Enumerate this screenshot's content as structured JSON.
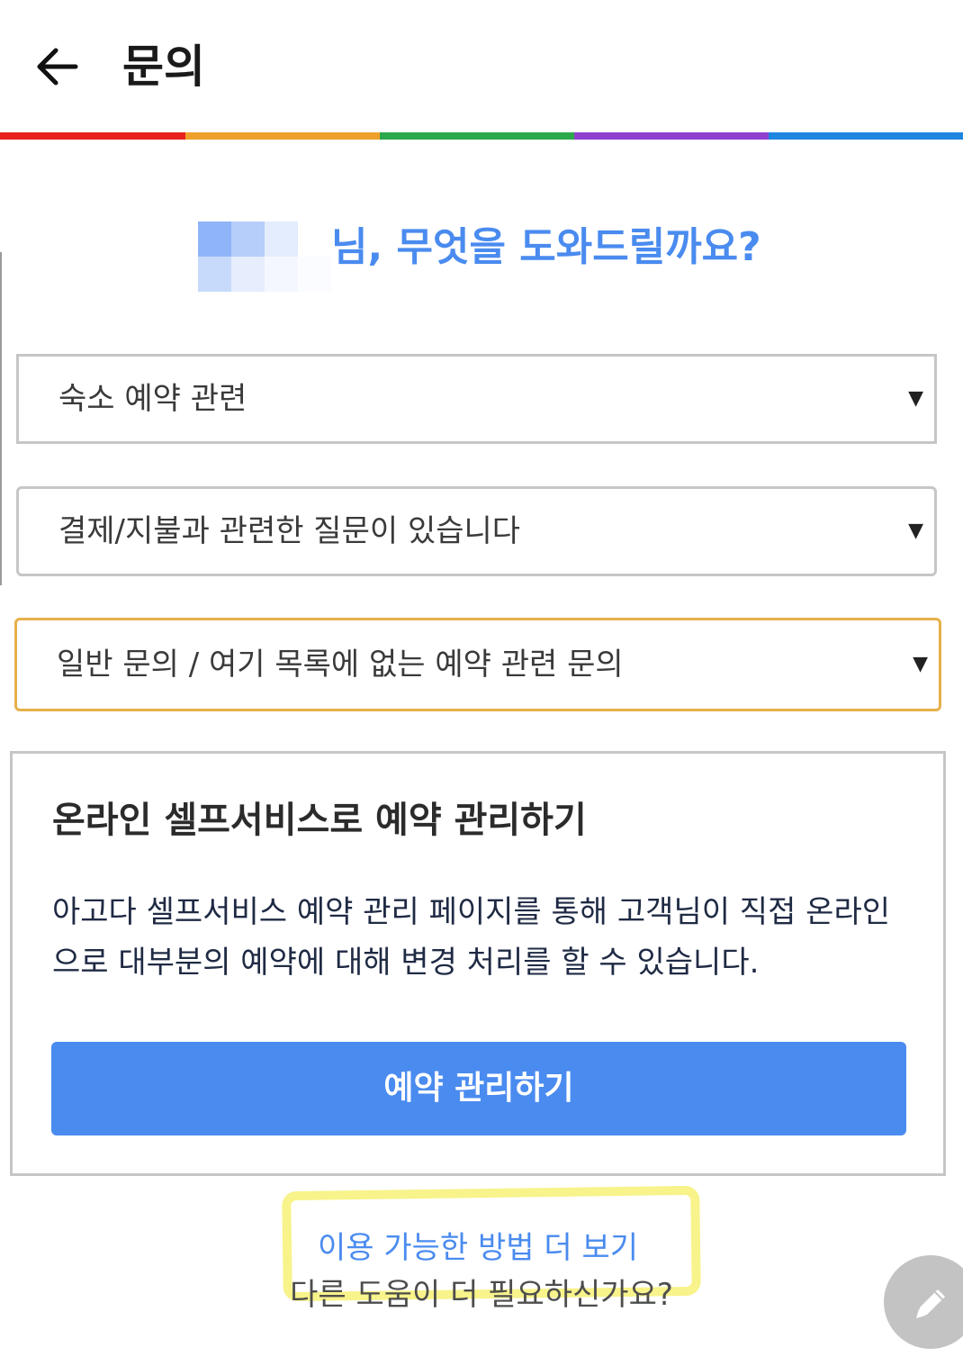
{
  "header": {
    "back_icon": "arrow-left-icon",
    "title": "문의"
  },
  "rainbow_colors": [
    "#e8211f",
    "#eea12a",
    "#2ba84a",
    "#8f3fd0",
    "#1f86e0"
  ],
  "greeting": {
    "text": "님, 무엇을 도와드릴까요?",
    "color": "#4a8bef"
  },
  "selects": [
    {
      "value": "숙소 예약 관련"
    },
    {
      "value": "결제/지불과 관련한 질문이 있습니다"
    },
    {
      "value": "일반 문의 / 여기 목록에 없는 예약 관련 문의"
    }
  ],
  "self_service": {
    "title": "온라인 셀프서비스로 예약 관리하기",
    "description": "아고다 셀프서비스 예약 관리 페이지를 통해 고객님이 직접 온라인으로 대부분의 예약에 대해 변경 처리를 할 수 있습니다.",
    "button_label": "예약 관리하기",
    "button_color": "#4a8bf0"
  },
  "more_options_link": "이용 가능한 방법 더 보기",
  "help_text": "다른 도움이 더 필요하신가요?",
  "fab_icon": "pencil-icon"
}
